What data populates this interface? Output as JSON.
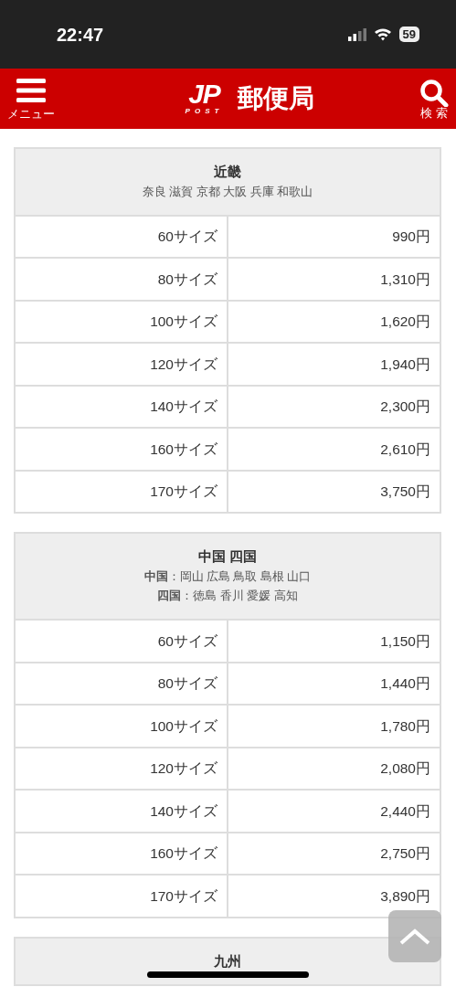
{
  "status_bar": {
    "time": "22:47",
    "battery": "59"
  },
  "header": {
    "menu_label": "メニュー",
    "logo_mark": "JP",
    "logo_sub": "POST",
    "site_name": "郵便局",
    "search_label": "検 索"
  },
  "regions": [
    {
      "name": "近畿",
      "areas": [
        "奈良 滋賀 京都 大阪 兵庫 和歌山"
      ],
      "rows": [
        {
          "size": "60サイズ",
          "price": "990円"
        },
        {
          "size": "80サイズ",
          "price": "1,310円"
        },
        {
          "size": "100サイズ",
          "price": "1,620円"
        },
        {
          "size": "120サイズ",
          "price": "1,940円"
        },
        {
          "size": "140サイズ",
          "price": "2,300円"
        },
        {
          "size": "160サイズ",
          "price": "2,610円"
        },
        {
          "size": "170サイズ",
          "price": "3,750円"
        }
      ]
    },
    {
      "name": "中国 四国",
      "areas": [
        "**中国**：岡山 広島 鳥取 島根 山口",
        "**四国**：徳島 香川 愛媛 高知"
      ],
      "rows": [
        {
          "size": "60サイズ",
          "price": "1,150円"
        },
        {
          "size": "80サイズ",
          "price": "1,440円"
        },
        {
          "size": "100サイズ",
          "price": "1,780円"
        },
        {
          "size": "120サイズ",
          "price": "2,080円"
        },
        {
          "size": "140サイズ",
          "price": "2,440円"
        },
        {
          "size": "160サイズ",
          "price": "2,750円"
        },
        {
          "size": "170サイズ",
          "price": "3,890円"
        }
      ]
    },
    {
      "name": "九州"
    }
  ]
}
